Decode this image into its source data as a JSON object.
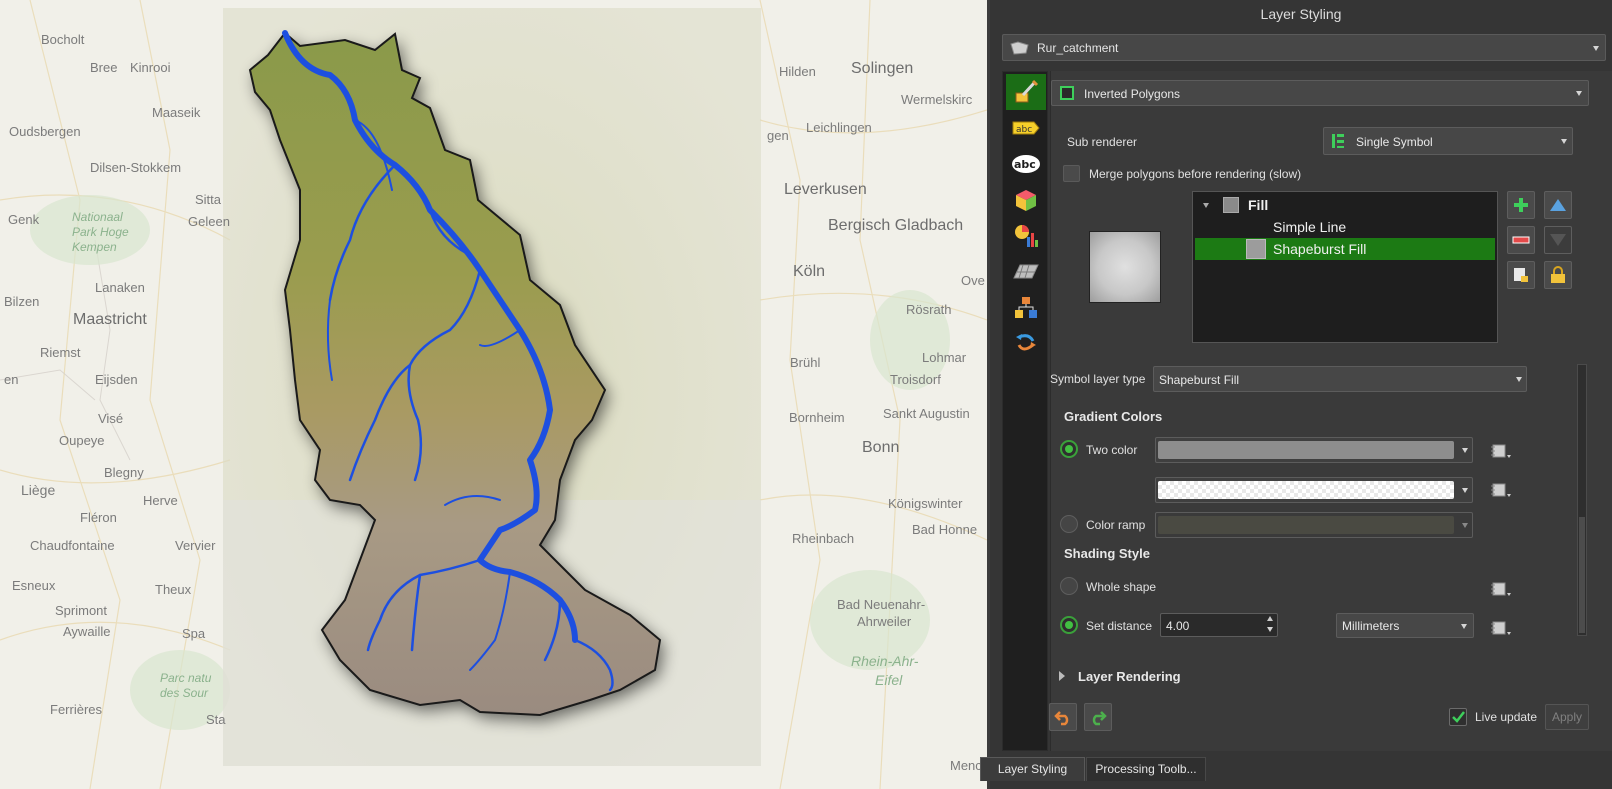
{
  "map": {
    "places": [
      {
        "key": "bocholt",
        "label": "Bocholt"
      },
      {
        "key": "bree",
        "label": "Bree"
      },
      {
        "key": "kinrooi",
        "label": "Kinrooi"
      },
      {
        "key": "maaseik",
        "label": "Maaseik"
      },
      {
        "key": "oudsbergen",
        "label": "Oudsbergen"
      },
      {
        "key": "dilsen",
        "label": "Dilsen-Stokkem"
      },
      {
        "key": "genk",
        "label": "Genk"
      },
      {
        "key": "sitta",
        "label": "Sitta"
      },
      {
        "key": "geleen",
        "label": "Geleen"
      },
      {
        "key": "lanaken",
        "label": "Lanaken"
      },
      {
        "key": "bilzen",
        "label": "Bilzen"
      },
      {
        "key": "maastricht",
        "label": "Maastricht"
      },
      {
        "key": "riemst",
        "label": "Riemst"
      },
      {
        "key": "eijsden",
        "label": "Eijsden"
      },
      {
        "key": "en",
        "label": "en"
      },
      {
        "key": "vise",
        "label": "Visé"
      },
      {
        "key": "oupeye",
        "label": "Oupeye"
      },
      {
        "key": "blegny",
        "label": "Blegny"
      },
      {
        "key": "liege",
        "label": "Liège"
      },
      {
        "key": "herve",
        "label": "Herve"
      },
      {
        "key": "fleron",
        "label": "Fléron"
      },
      {
        "key": "chaudfontaine",
        "label": "Chaudfontaine"
      },
      {
        "key": "vervier",
        "label": "Vervier"
      },
      {
        "key": "esneux",
        "label": "Esneux"
      },
      {
        "key": "theux",
        "label": "Theux"
      },
      {
        "key": "sprimont",
        "label": "Sprimont"
      },
      {
        "key": "aywaille",
        "label": "Aywaille"
      },
      {
        "key": "spa",
        "label": "Spa"
      },
      {
        "key": "ferrieres",
        "label": "Ferrières"
      },
      {
        "key": "sta",
        "label": "Sta"
      },
      {
        "key": "hilden",
        "label": "Hilden"
      },
      {
        "key": "solingen",
        "label": "Solingen"
      },
      {
        "key": "wermelskirc",
        "label": "Wermelskirc"
      },
      {
        "key": "gen",
        "label": "gen"
      },
      {
        "key": "leichlingen",
        "label": "Leichlingen"
      },
      {
        "key": "leverkusen",
        "label": "Leverkusen"
      },
      {
        "key": "bergisch",
        "label": "Bergisch Gladbach"
      },
      {
        "key": "koln",
        "label": "Köln"
      },
      {
        "key": "ove",
        "label": "Ove"
      },
      {
        "key": "rosrath",
        "label": "Rösrath"
      },
      {
        "key": "bruhl",
        "label": "Brühl"
      },
      {
        "key": "lohmar",
        "label": "Lohmar"
      },
      {
        "key": "troisdorf",
        "label": "Troisdorf"
      },
      {
        "key": "bornheim",
        "label": "Bornheim"
      },
      {
        "key": "sankt",
        "label": "Sankt Augustin"
      },
      {
        "key": "bonn",
        "label": "Bonn"
      },
      {
        "key": "konigswinter",
        "label": "Königswinter"
      },
      {
        "key": "rheinbach",
        "label": "Rheinbach"
      },
      {
        "key": "badhonnef",
        "label": "Bad Honne"
      },
      {
        "key": "badneuenahr1",
        "label": "Bad Neuenahr-"
      },
      {
        "key": "badneuenahr2",
        "label": "Ahrweiler"
      },
      {
        "key": "rheinahr1",
        "label": "Rhein-Ahr-"
      },
      {
        "key": "rheinahr2",
        "label": "Eifel"
      },
      {
        "key": "menc",
        "label": "Menc"
      }
    ],
    "parks": [
      {
        "key": "np",
        "lines": [
          "Nationaal",
          "Park Hoge",
          "Kempen"
        ]
      },
      {
        "key": "pn",
        "lines": [
          "Parc natu",
          "des Sour"
        ]
      }
    ]
  },
  "dock": {
    "title": "Layer Styling",
    "layer_name": "Rur_catchment",
    "renderer": "Inverted Polygons",
    "sub_renderer_label": "Sub renderer",
    "sub_renderer_value": "Single Symbol",
    "merge_label": "Merge polygons before rendering (slow)",
    "merge_checked": false,
    "symbol_tree": [
      {
        "label": "Fill",
        "type": "parent"
      },
      {
        "label": "Simple Line",
        "type": "child"
      },
      {
        "label": "Shapeburst Fill",
        "type": "child",
        "selected": true
      }
    ],
    "symbol_layer_type_label": "Symbol layer type",
    "symbol_layer_type_value": "Shapeburst Fill",
    "gradient_colors_heading": "Gradient Colors",
    "two_color_label": "Two color",
    "color_ramp_label": "Color ramp",
    "shading_style_heading": "Shading Style",
    "whole_shape_label": "Whole shape",
    "set_distance_label": "Set distance",
    "set_distance_value": "4.00",
    "distance_unit": "Millimeters",
    "layer_rendering_label": "Layer Rendering",
    "live_update_label": "Live update",
    "live_update_checked": true,
    "apply_label": "Apply",
    "colors": {
      "selection_green": "#1c7a14",
      "color1": "#8e8e8e",
      "color2": "#ffffff",
      "river": "#1d4fe0",
      "boundary": "#1a1a1a"
    }
  },
  "bottom_tabs": [
    {
      "label": "Layer Styling",
      "active": true
    },
    {
      "label": "Processing Toolb...",
      "active": false
    }
  ],
  "side_icons": [
    {
      "name": "symbology-paintbrush-icon",
      "active": true
    },
    {
      "name": "labels-icon"
    },
    {
      "name": "masks-abc-icon"
    },
    {
      "name": "3d-view-cube-icon"
    },
    {
      "name": "diagrams-chart-icon"
    },
    {
      "name": "fields-table-icon"
    },
    {
      "name": "rendering-hierarchy-icon"
    },
    {
      "name": "history-undo-icon"
    }
  ]
}
